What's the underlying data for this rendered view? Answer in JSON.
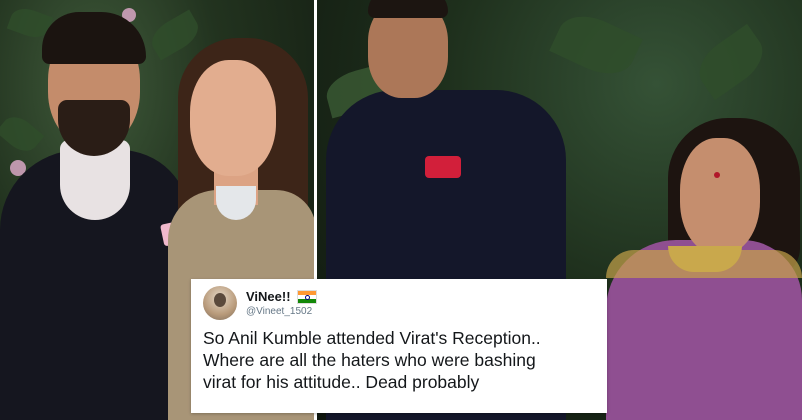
{
  "tweet": {
    "display_name": "ViNee!!",
    "flag_icon": "india-flag-icon",
    "handle": "@Vineet_1502",
    "text_lines": [
      "So Anil Kumble attended Virat's Reception..",
      "Where are all the haters who were bashing",
      "virat for his attitude.. Dead probably"
    ]
  },
  "colors": {
    "tweet_background": "#ffffff",
    "kumble_pocket_square": "#d21f3a",
    "saree": "#8f4f91"
  }
}
